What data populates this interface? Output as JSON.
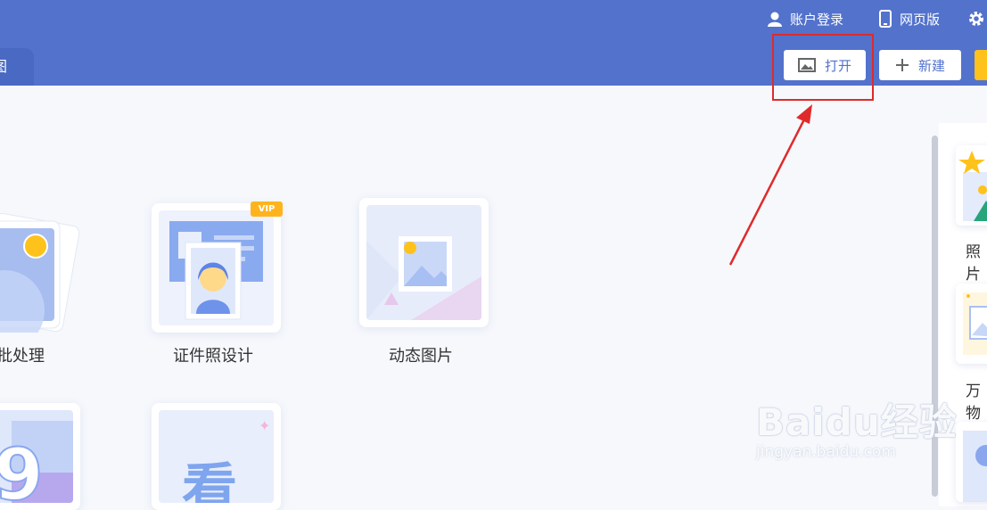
{
  "header": {
    "active_tab_partial": "图",
    "login_label": "账户登录",
    "web_version_label": "网页版",
    "open_label": "打开",
    "new_label": "新建"
  },
  "features": [
    {
      "label": "批处理"
    },
    {
      "label": "证件照设计",
      "badge": "VIP"
    },
    {
      "label": "动态图片"
    }
  ],
  "second_row": {
    "card2_text": "看"
  },
  "sidebar": {
    "items": [
      {
        "label": "照片"
      },
      {
        "label": "万物"
      }
    ]
  },
  "watermark": {
    "main": "Baidu经验",
    "sub": "jingyan.baidu.com"
  },
  "colors": {
    "header_bg": "#5272cc",
    "accent_yellow": "#ffc21a",
    "highlight_red": "#e02a2a"
  }
}
